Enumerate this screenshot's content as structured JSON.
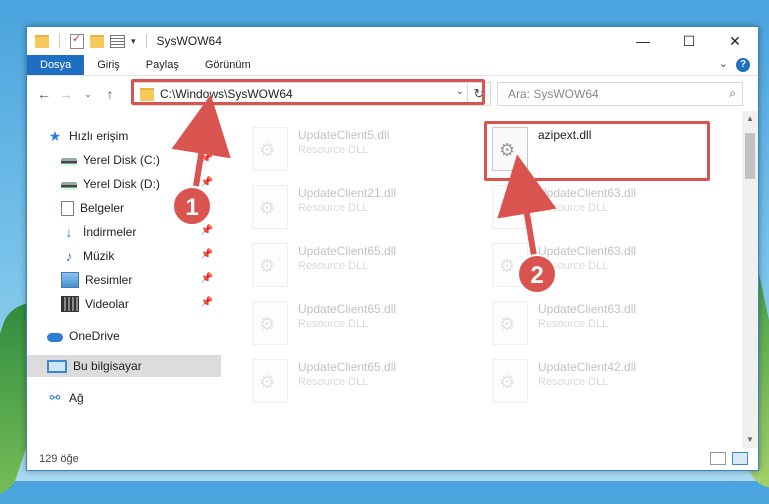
{
  "window": {
    "title": "SysWOW64",
    "controls": [
      "—",
      "☐",
      "✕"
    ]
  },
  "ribbon": {
    "tabs": [
      "Dosya",
      "Giriş",
      "Paylaş",
      "Görünüm"
    ],
    "help": "?"
  },
  "address": {
    "path": "C:\\Windows\\SysWOW64",
    "search_placeholder": "Ara: SysWOW64"
  },
  "sidebar": {
    "quick_access": "Hızlı erişim",
    "items": [
      {
        "label": "Yerel Disk (C:)",
        "icon": "drive-icon"
      },
      {
        "label": "Yerel Disk (D:)",
        "icon": "drive-icon"
      },
      {
        "label": "Belgeler",
        "icon": "documents-icon"
      },
      {
        "label": "İndirmeler",
        "icon": "downloads-icon"
      },
      {
        "label": "Müzik",
        "icon": "music-icon"
      },
      {
        "label": "Resimler",
        "icon": "pictures-icon"
      },
      {
        "label": "Videolar",
        "icon": "videos-icon"
      }
    ],
    "onedrive": "OneDrive",
    "this_pc": "Bu bilgisayar",
    "network": "Ağ"
  },
  "files": [
    {
      "name": "UpdateClient5.dll",
      "type": "Resource DLL",
      "faded": true
    },
    {
      "name": "azipext.dll",
      "type": "",
      "faded": false
    },
    {
      "name": "UpdateClient21.dll",
      "type": "Resource DLL",
      "faded": true
    },
    {
      "name": "UpdateClient63.dll",
      "type": "Resource DLL",
      "faded": true
    },
    {
      "name": "UpdateClient65.dll",
      "type": "Resource DLL",
      "faded": true
    },
    {
      "name": "UpdateClient63.dll",
      "type": "Resource DLL",
      "faded": true
    },
    {
      "name": "UpdateClient65.dll",
      "type": "Resource DLL",
      "faded": true
    },
    {
      "name": "UpdateClient63.dll",
      "type": "Resource DLL",
      "faded": true
    },
    {
      "name": "UpdateClient65.dll",
      "type": "Resource DLL",
      "faded": true
    },
    {
      "name": "UpdateClient42.dll",
      "type": "Resource DLL",
      "faded": true
    }
  ],
  "annotations": {
    "marker1": "1",
    "marker2": "2",
    "highlight_color": "#d9534f"
  },
  "status": {
    "count": "129 öğe"
  }
}
